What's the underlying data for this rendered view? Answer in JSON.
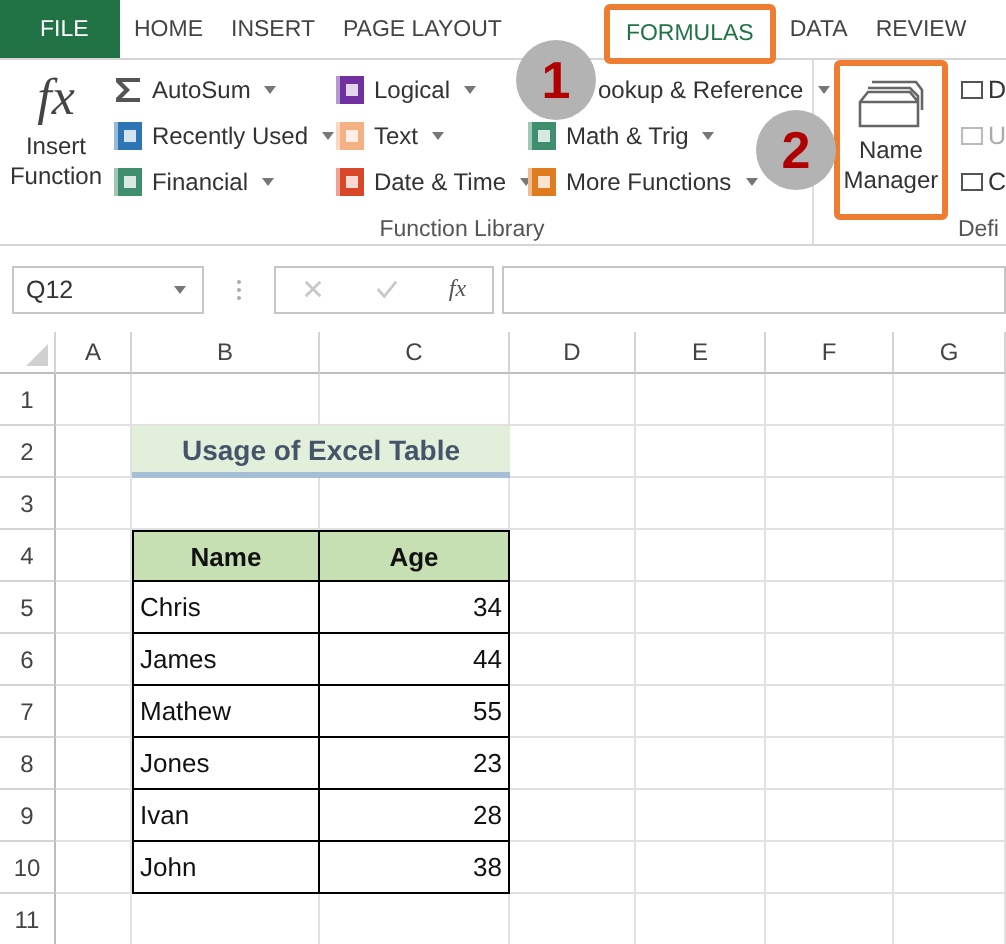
{
  "tabs": [
    {
      "label": "FILE",
      "kind": "file",
      "selected": false
    },
    {
      "label": "HOME",
      "kind": "tab",
      "selected": false
    },
    {
      "label": "INSERT",
      "kind": "tab",
      "selected": false
    },
    {
      "label": "PAGE LAYOUT",
      "kind": "tab",
      "selected": false
    },
    {
      "label": "FORMULAS",
      "kind": "tab",
      "selected": true,
      "highlighted": true
    },
    {
      "label": "DATA",
      "kind": "tab",
      "selected": false
    },
    {
      "label": "REVIEW",
      "kind": "tab",
      "selected": false
    }
  ],
  "ribbon": {
    "insert_function": {
      "symbol": "fx",
      "label": "Insert Function"
    },
    "columns": [
      [
        {
          "label": "AutoSum",
          "kind": "sigma",
          "color": "#555555"
        },
        {
          "label": "Recently Used",
          "kind": "book",
          "color": "#2e75b6"
        },
        {
          "label": "Financial",
          "kind": "book",
          "color": "#3f8f6e"
        }
      ],
      [
        {
          "label": "Logical",
          "kind": "book",
          "color": "#7030a0"
        },
        {
          "label": "Text",
          "kind": "book",
          "color": "#f4b183"
        },
        {
          "label": "Date & Time",
          "kind": "book",
          "color": "#d9472b"
        }
      ],
      [
        {
          "label": "ookup & Reference",
          "kind": "covered"
        },
        {
          "label": "Math & Trig",
          "kind": "book",
          "color": "#3f8f6e"
        },
        {
          "label": "More Functions",
          "kind": "book",
          "color": "#e07b20"
        }
      ]
    ],
    "group_label": "Function Library",
    "name_manager": {
      "label": "Name Manager",
      "highlighted": true
    },
    "defined_names": {
      "items": [
        {
          "label": "D",
          "disabled": false
        },
        {
          "label": "U",
          "disabled": true
        },
        {
          "label": "C",
          "disabled": false
        }
      ],
      "group_label": "Defi"
    }
  },
  "annotations": [
    {
      "number": "1"
    },
    {
      "number": "2"
    }
  ],
  "formula_bar": {
    "name_box": "Q12",
    "fx": "fx"
  },
  "sheet": {
    "columns": [
      "A",
      "B",
      "C",
      "D",
      "E",
      "F",
      "G"
    ],
    "rows": [
      "1",
      "2",
      "3",
      "4",
      "5",
      "6",
      "7",
      "8",
      "9",
      "10",
      "11"
    ],
    "title": "Usage of Excel Table",
    "headers": [
      "Name",
      "Age"
    ],
    "data": [
      [
        "Chris",
        "34"
      ],
      [
        "James",
        "44"
      ],
      [
        "Mathew",
        "55"
      ],
      [
        "Jones",
        "23"
      ],
      [
        "Ivan",
        "28"
      ],
      [
        "John",
        "38"
      ]
    ]
  }
}
